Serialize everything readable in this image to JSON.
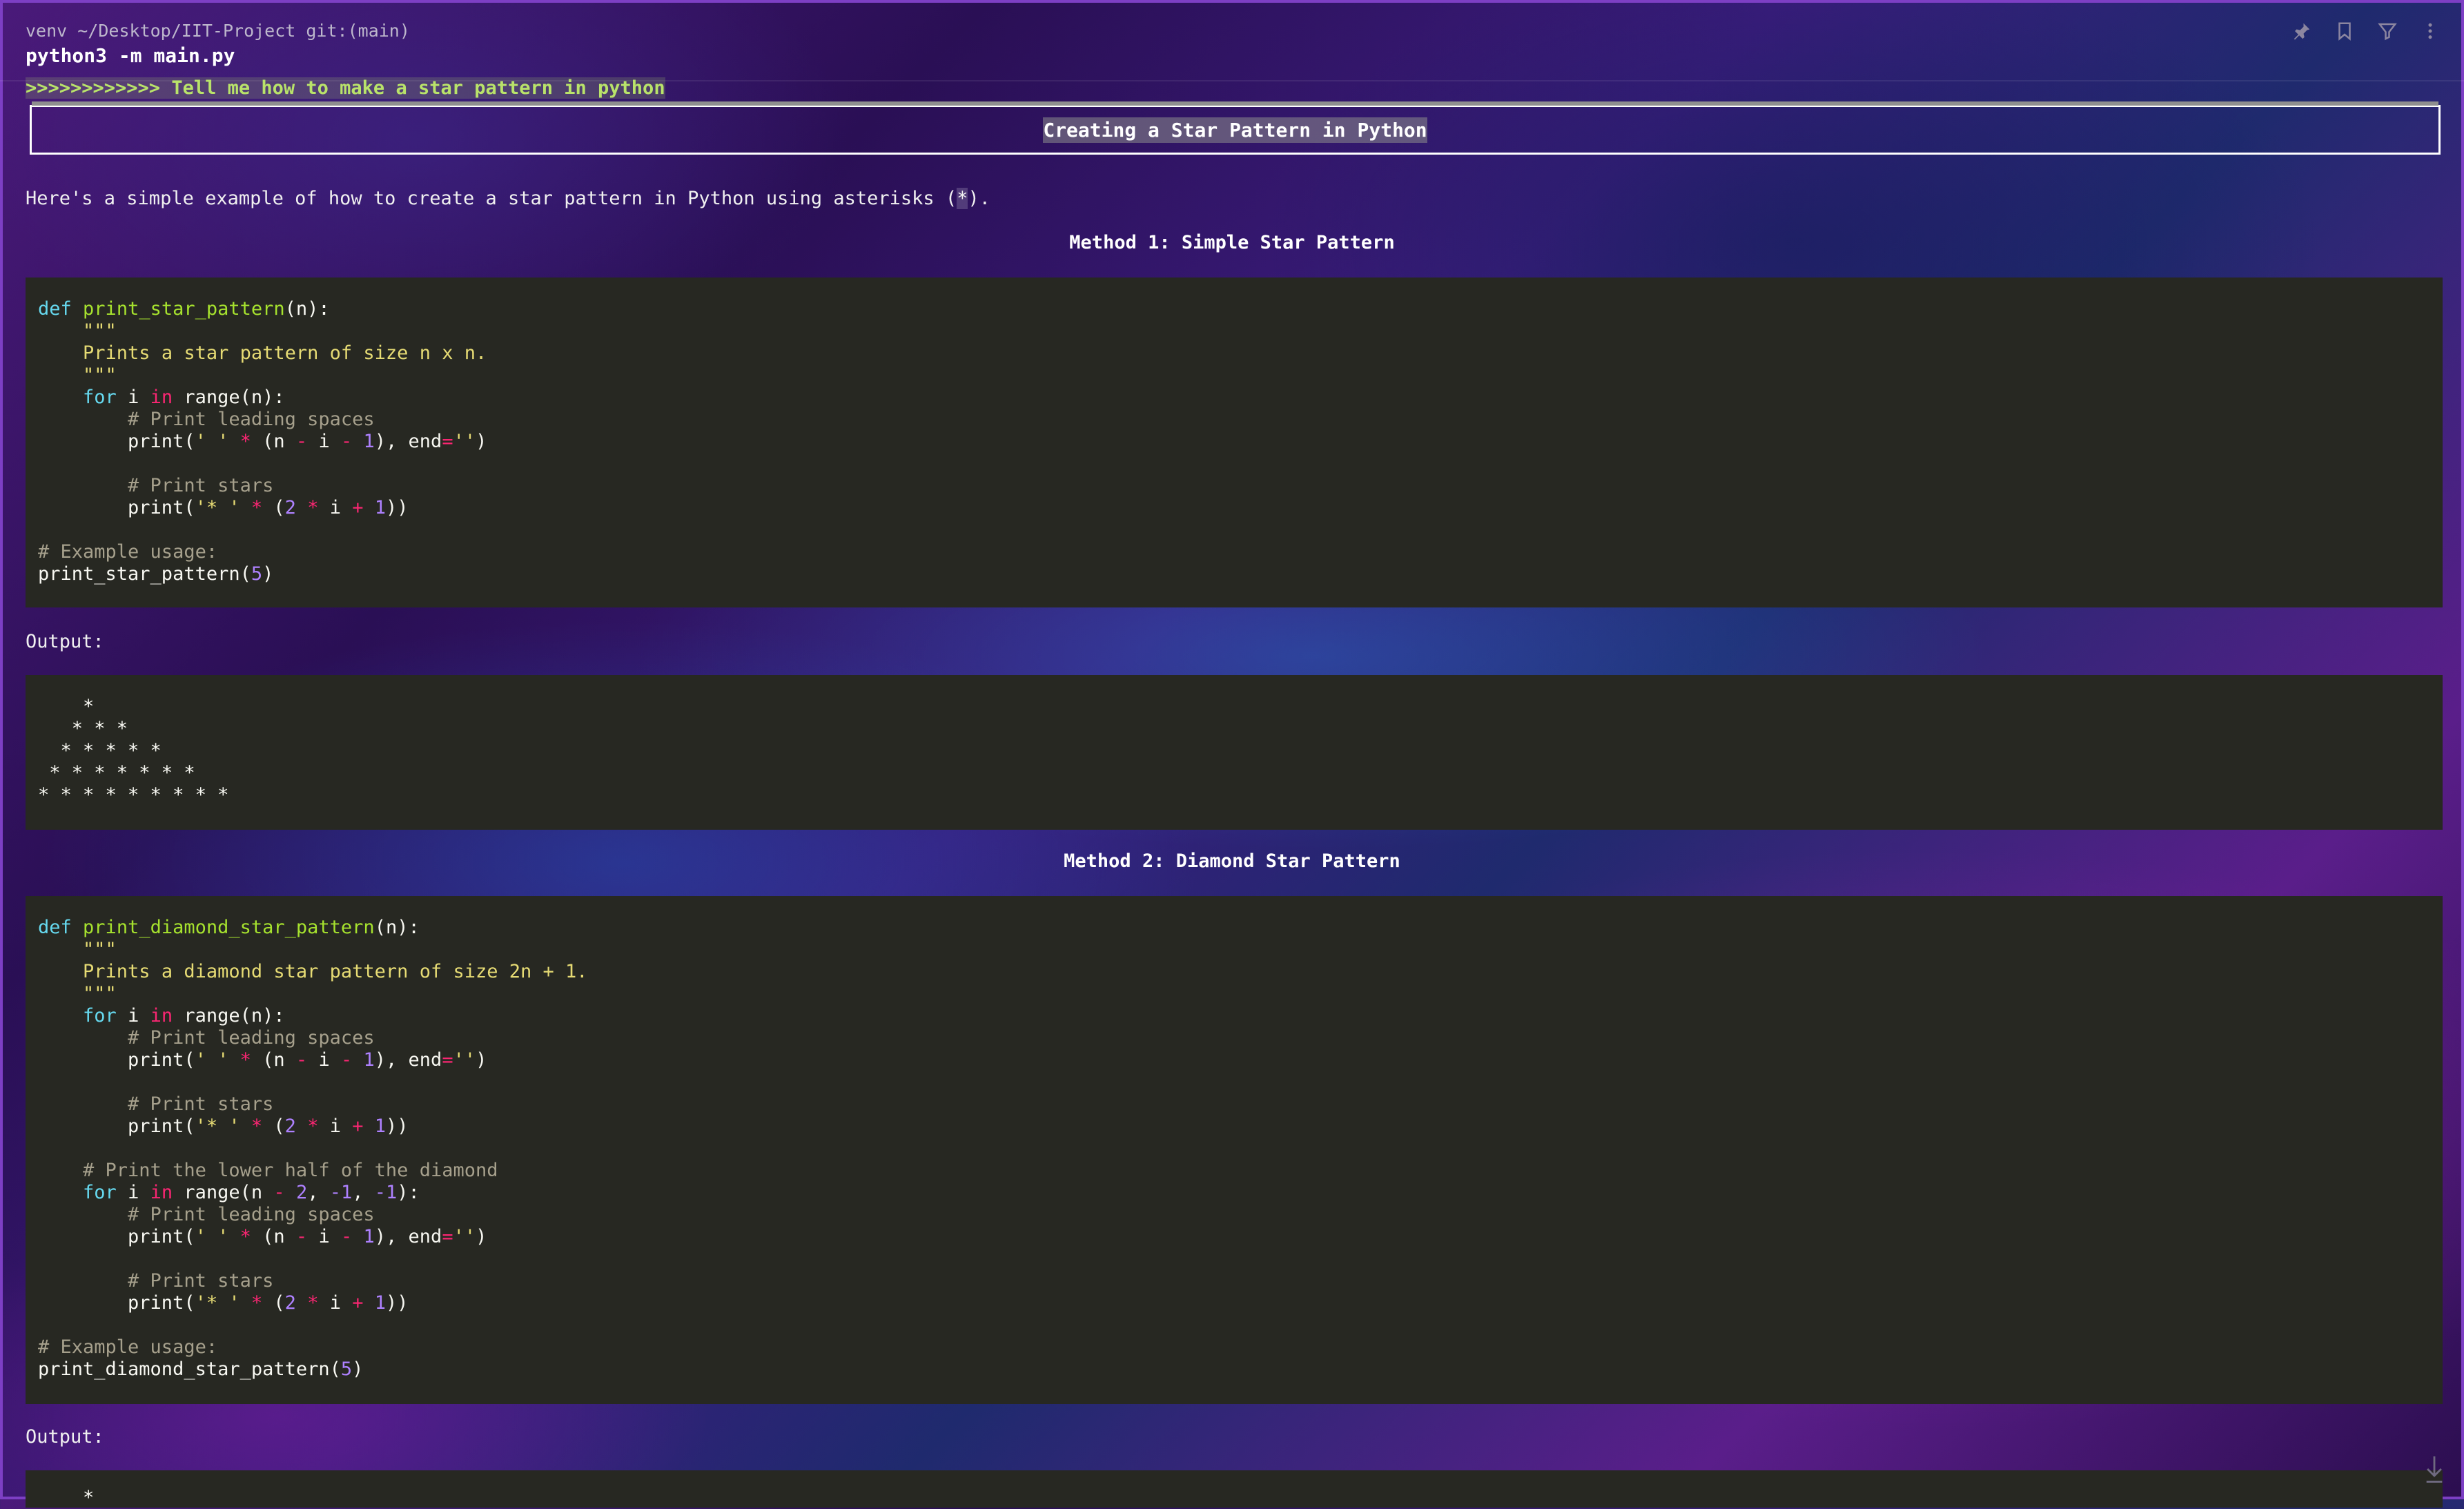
{
  "terminal": {
    "path": "venv ~/Desktop/IIT-Project git:(main)",
    "command": "python3 -m main.py",
    "prompt_arrows": ">>>>>>>>>>>>",
    "prompt_text": " Tell me how to make a star pattern in python"
  },
  "toolbar": {
    "icons": [
      "pin-icon",
      "bookmark-icon",
      "filter-icon",
      "more-vertical-icon"
    ]
  },
  "response": {
    "title": "Creating a Star Pattern in Python",
    "intro_before": "Here's a simple example of how to create a star pattern in Python using asterisks (",
    "intro_code": "*",
    "intro_after": ").",
    "method1_heading": "Method 1: Simple Star Pattern",
    "method2_heading": "Method 2: Diamond Star Pattern",
    "output_label_1": "Output:",
    "output_label_2": "Output:",
    "output_1": "    *\n   * * *\n  * * * * *\n * * * * * * *\n* * * * * * * * *",
    "output_2": "    *"
  },
  "colors": {
    "code_bg": "#272822",
    "keyword": "#66d9ef",
    "function": "#a6e22e",
    "operator": "#f92672",
    "string": "#e6db74",
    "number": "#ae81ff",
    "comment": "#a6a08c",
    "prompt": "#b9e36a"
  }
}
